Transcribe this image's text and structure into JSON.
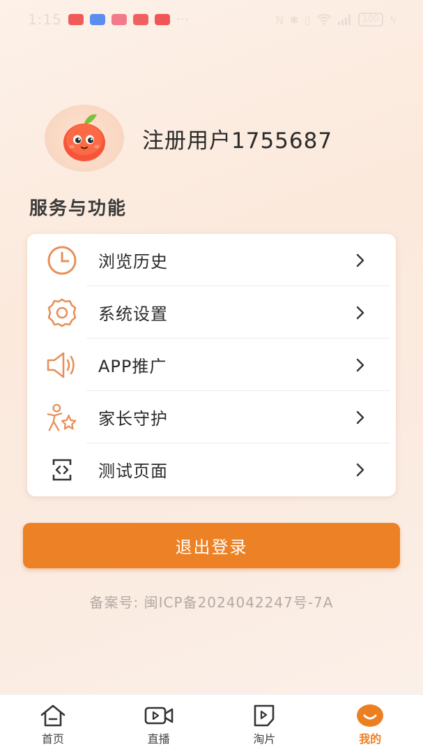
{
  "status_bar": {
    "time": "1:15",
    "battery": "100"
  },
  "profile": {
    "username": "注册用户1755687"
  },
  "section": {
    "title": "服务与功能"
  },
  "menu": {
    "items": [
      {
        "label": "浏览历史",
        "icon": "clock-icon"
      },
      {
        "label": "系统设置",
        "icon": "gear-icon"
      },
      {
        "label": "APP推广",
        "icon": "speaker-icon"
      },
      {
        "label": "家长守护",
        "icon": "family-icon"
      },
      {
        "label": "测试页面",
        "icon": "code-icon"
      }
    ]
  },
  "logout": {
    "label": "退出登录"
  },
  "footer": {
    "icp": "备案号: 闽ICP备2024042247号-7A"
  },
  "tabbar": {
    "tabs": [
      {
        "label": "首页",
        "icon": "home-icon"
      },
      {
        "label": "直播",
        "icon": "video-icon"
      },
      {
        "label": "淘片",
        "icon": "play-file-icon"
      },
      {
        "label": "我的",
        "icon": "smile-icon"
      }
    ],
    "active_index": 3
  },
  "colors": {
    "accent": "#ec8125",
    "icon": "#e88f59"
  }
}
